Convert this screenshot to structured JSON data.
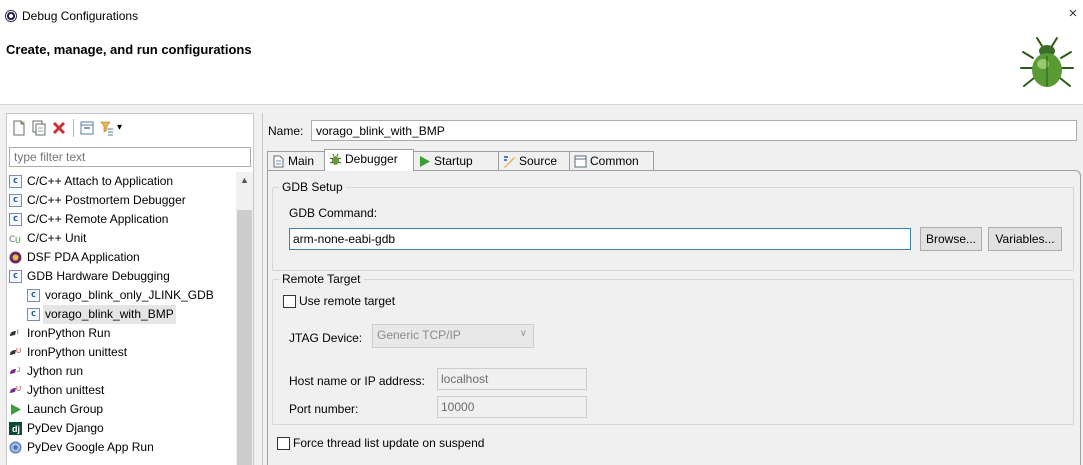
{
  "window": {
    "title": "Debug Configurations",
    "close_glyph": "×"
  },
  "header": {
    "heading": "Create, manage, and run configurations",
    "icon": "debug-bug-icon"
  },
  "toolbar": {
    "buttons": [
      "new-configuration-icon",
      "duplicate-icon",
      "delete-icon",
      "collapse-all-icon",
      "filter-icon"
    ],
    "menu_arrow": "▾"
  },
  "filter": {
    "placeholder": "type filter text"
  },
  "tree": {
    "items": [
      {
        "label": "C/C++ Attach to Application",
        "icon": "c-config-icon"
      },
      {
        "label": "C/C++ Postmortem Debugger",
        "icon": "c-config-icon"
      },
      {
        "label": "C/C++ Remote Application",
        "icon": "c-config-icon"
      },
      {
        "label": "C/C++ Unit",
        "icon": "cu-unit-icon"
      },
      {
        "label": "DSF PDA Application",
        "icon": "pda-icon"
      },
      {
        "label": "GDB Hardware Debugging",
        "icon": "c-config-icon"
      },
      {
        "label": "vorago_blink_only_JLINK_GDB",
        "icon": "c-config-icon"
      },
      {
        "label": "vorago_blink_with_BMP",
        "icon": "c-config-icon"
      },
      {
        "label": "IronPython Run",
        "icon": "ironpython-icon"
      },
      {
        "label": "IronPython unittest",
        "icon": "ironpython-unittest-icon"
      },
      {
        "label": "Jython run",
        "icon": "jython-icon"
      },
      {
        "label": "Jython unittest",
        "icon": "jython-unittest-icon"
      },
      {
        "label": "Launch Group",
        "icon": "launch-group-icon"
      },
      {
        "label": "PyDev Django",
        "icon": "django-icon"
      },
      {
        "label": "PyDev Google App Run",
        "icon": "google-app-icon"
      }
    ],
    "selected": "vorago_blink_with_BMP",
    "scroll_up": "▲"
  },
  "config": {
    "name_label": "Name:",
    "name_value": "vorago_blink_with_BMP"
  },
  "tabs": [
    {
      "label": "Main",
      "icon": "main-tab-icon"
    },
    {
      "label": "Debugger",
      "icon": "debugger-tab-icon",
      "active": true
    },
    {
      "label": "Startup",
      "icon": "startup-tab-icon"
    },
    {
      "label": "Source",
      "icon": "source-tab-icon"
    },
    {
      "label": "Common",
      "icon": "common-tab-icon"
    }
  ],
  "gdb_setup": {
    "title": "GDB Setup",
    "command_label": "GDB Command:",
    "command_value": "arm-none-eabi-gdb",
    "browse_label": "Browse...",
    "variables_label": "Variables..."
  },
  "remote_target": {
    "title": "Remote Target",
    "use_remote_label": "Use remote target",
    "use_remote_checked": false,
    "jtag_label": "JTAG Device:",
    "jtag_value": "Generic TCP/IP",
    "host_label": "Host name or IP address:",
    "host_value": "localhost",
    "port_label": "Port number:",
    "port_value": "10000"
  },
  "force_thread": {
    "label": "Force thread list update on suspend",
    "checked": false
  },
  "colors": {
    "selection": "#e5e5e5",
    "panel_bg": "#f0f0f0",
    "focus_border": "#3c7fb1"
  }
}
